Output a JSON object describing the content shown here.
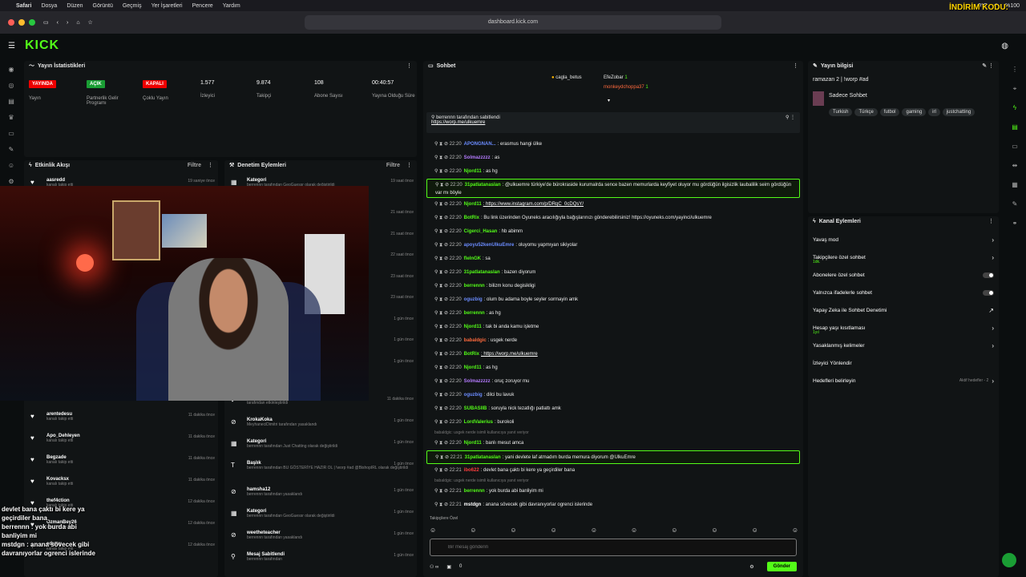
{
  "mac": {
    "app": "Safari",
    "menus": [
      "Dosya",
      "Düzen",
      "Görüntü",
      "Geçmiş",
      "Yer İşaretleri",
      "Pencere",
      "Yardım"
    ],
    "weather": "9°C",
    "battery": "%100",
    "promo": "İNDİRİM KODU:"
  },
  "browser": {
    "url": "dashboard.kick.com"
  },
  "kick": {
    "logo": "KICK"
  },
  "stats": {
    "title": "Yayın İstatistikleri",
    "live_badge": "YAYINDA",
    "live_label": "Yayın",
    "partner_badge": "AÇIK",
    "partner_label": "Partnerlik Gelir Programı",
    "multi_badge": "KAPALI",
    "multi_label": "Çoklu Yayın",
    "viewers": "1.577",
    "viewers_label": "İzleyici",
    "followers": "9.874",
    "followers_label": "Takipçi",
    "subs": "108",
    "subs_label": "Abone Sayısı",
    "uptime": "00:40:57",
    "uptime_label": "Yayına Olduğu Süre"
  },
  "activity": {
    "title": "Etkinlik Akışı",
    "filter": "Filtre",
    "items": [
      {
        "name": "aasredd",
        "sub": "kanalı takip etti",
        "time": "19 saniye önce"
      },
      {
        "name": "arentedesu",
        "sub": "kanalı takip etti",
        "time": "11 dakika önce"
      },
      {
        "name": "Apo_Dehleyen",
        "sub": "kanalı takip etti",
        "time": "11 dakika önce"
      },
      {
        "name": "Begzade",
        "sub": "kanalı takip etti",
        "time": "11 dakika önce"
      },
      {
        "name": "Kovacksx",
        "sub": "kanalı takip etti",
        "time": "11 dakika önce"
      },
      {
        "name": "thef4ction",
        "sub": "kanalı takip etti",
        "time": "12 dakika önce"
      },
      {
        "name": "OzmanBey26",
        "sub": "kanalı takip etti",
        "time": "12 dakika önce"
      },
      {
        "name": "edusw",
        "sub": "kanalı takip etti",
        "time": "12 dakika önce"
      }
    ]
  },
  "moderation": {
    "title": "Denetim Eylemleri",
    "filter": "Filtre",
    "top": [
      {
        "name": "Kategori",
        "sub": "berrennn tarafından GeoGuessr olarak değiştirildi",
        "time": "19 saat önce"
      }
    ],
    "side_times": [
      "21 saat önce",
      "21 saat önce",
      "22 saat önce",
      "23 saat önce",
      "23 saat önce",
      "1 gün önce",
      "1 gün önce",
      "1 gün önce"
    ],
    "items": [
      {
        "name": "UlkuEmre",
        "sub": "tarafından etkinleştirildi",
        "time": "11 dakika önce"
      },
      {
        "name": "KrokaKoka",
        "sub": "MeyhaneciDimitri tarafından yasaklandı",
        "time": "1 gün önce"
      },
      {
        "name": "Kategori",
        "sub": "berrennn tarafından Just Chatting olarak değiştirildi",
        "time": "1 gün önce"
      },
      {
        "name": "Başlık",
        "sub": "berrennn tarafından BU GÖSTERİYE HAZIR OL | !worp #ad @BishopIRL olarak değiştirildi",
        "time": "1 gün önce"
      },
      {
        "name": "hamsha12",
        "sub": "berrennn tarafından yasaklandı",
        "time": "1 gün önce"
      },
      {
        "name": "Kategori",
        "sub": "berrennn tarafından GeoGuessr olarak değiştirildi",
        "time": "1 gün önce"
      },
      {
        "name": "weetheteacher",
        "sub": "berrennn tarafından yasaklandı",
        "time": "1 gün önce"
      },
      {
        "name": "Mesaj Sabitlendi",
        "sub": "berrennn tarafından",
        "time": "1 gün önce"
      }
    ]
  },
  "overlay_chat": [
    "devlet bana çaktı bi kere ya",
    "geçirdiler bana",
    "berrennn : yok burda abi",
    "banliyim mi",
    "mstdgn : anana sövecek gibi",
    "davranıyorlar ogrenci islerinde"
  ],
  "chat": {
    "title": "Sohbet",
    "leaders": [
      {
        "name": "cagla_betus",
        "n": "1"
      },
      {
        "name": "EfeZobar",
        "n": "1"
      },
      {
        "name": "monkeydchoppa37",
        "n": "1"
      }
    ],
    "pinned_by": "berrennn tarafından sabitlendi",
    "pinned_link": "https://worp.me/ulkuemre",
    "messages": [
      {
        "time": "22:20",
        "user": "APONGNAN...",
        "color": "#6b8cff",
        "text": ": erasmus hangi ülke",
        "type": "normal"
      },
      {
        "time": "22:20",
        "user": "Solmazzzzz",
        "color": "#b57bff",
        "text": ": as",
        "type": "normal"
      },
      {
        "time": "22:20",
        "user": "Njord11",
        "color": "#53fc18",
        "text": ": as hg",
        "type": "normal"
      },
      {
        "time": "22:20",
        "user": "31patlatanaslan",
        "color": "#53fc18",
        "text": ": @ulkuemre türkiye'de bürokraside kurumalrda sence bazen memurlarda keyfiyet oluyor mu gördüğün ilgisizlik laubalilik seim gördüğün var mı böyle",
        "type": "big"
      },
      {
        "time": "22:20",
        "user": "Njord11",
        "color": "#53fc18",
        "text": ": https://www.instagram.com/p/DRqC_0cDQsY/",
        "type": "link"
      },
      {
        "time": "22:20",
        "user": "BotRix",
        "color": "#53fc18",
        "text": ": Bu link üzerinden Oyuneks aracılığıyla bağışlarınızı gönderebilirsiniz! https://oyuneks.com/yayinci/ulkuemre",
        "type": "normal"
      },
      {
        "time": "22:20",
        "user": "Cigerci_Hasan",
        "color": "#53fc18",
        "text": ": hb abimm",
        "type": "normal"
      },
      {
        "time": "22:20",
        "user": "apoyu52kenUlkuEmre",
        "color": "#6b8cff",
        "text": ": oluyomu yapmıyan sikiyolar",
        "type": "normal"
      },
      {
        "time": "22:20",
        "user": "flelnGK",
        "color": "#53fc18",
        "text": ": sa",
        "type": "normal"
      },
      {
        "time": "22:20",
        "user": "31patlatanaslan",
        "color": "#53fc18",
        "text": ": bazen diyorum",
        "type": "normal"
      },
      {
        "time": "22:20",
        "user": "berrennn",
        "color": "#53fc18",
        "text": ": bilizm konu degisikligi",
        "type": "normal"
      },
      {
        "time": "22:20",
        "user": "oguzbig",
        "color": "#6b8cff",
        "text": ": olum bu adama boyle seyler sormayin amk",
        "type": "normal"
      },
      {
        "time": "22:20",
        "user": "berrennn",
        "color": "#53fc18",
        "text": ": as hg",
        "type": "normal"
      },
      {
        "time": "22:20",
        "user": "Njord11",
        "color": "#53fc18",
        "text": ": tak bi anda kamu işletme",
        "type": "normal"
      },
      {
        "time": "22:20",
        "user": "babaldgic",
        "color": "#ff6a3d",
        "text": ": usgek nerde",
        "type": "normal"
      },
      {
        "time": "22:20",
        "user": "BotRix",
        "color": "#53fc18",
        "text": ": https://worp.me/ulkuemre",
        "type": "link"
      },
      {
        "time": "22:20",
        "user": "Njord11",
        "color": "#53fc18",
        "text": ": as hg",
        "type": "normal"
      },
      {
        "time": "22:20",
        "user": "Solmazzzzz",
        "color": "#b57bff",
        "text": ": oruç zoruyor mu",
        "type": "normal"
      },
      {
        "time": "22:20",
        "user": "oguzbig",
        "color": "#6b8cff",
        "text": ": dilci bu lavuk",
        "type": "normal"
      },
      {
        "time": "22:20",
        "user": "SUBASIIB",
        "color": "#53fc18",
        "text": ": soruyla nick tezatlığı patlattı amk",
        "type": "normal"
      },
      {
        "time": "22:20",
        "user": "LordValerius",
        "color": "#53fc18",
        "text": ": burokoli",
        "type": "normal"
      },
      {
        "time": "",
        "user": "",
        "color": "#777",
        "text": "babaldgic: usgek nerde isimli kullanıcıya yanıt veriyor",
        "type": "reply"
      },
      {
        "time": "22:20",
        "user": "Njord11",
        "color": "#53fc18",
        "text": ": banlı mesut amca",
        "type": "normal"
      },
      {
        "time": "22:21",
        "user": "31patlatanaslan",
        "color": "#53fc18",
        "text": ": yani devlete laf atmadım burda memura diyorum @UlkuEmre",
        "type": "hl"
      },
      {
        "time": "22:21",
        "user": "ibo622",
        "color": "#ff3d3d",
        "text": ": devlet bana çaktı bi kere ya geçirdiler bana",
        "type": "normal"
      },
      {
        "time": "",
        "user": "",
        "color": "#777",
        "text": "babaldgic: usgek nerde isimli kullanıcıya yanıt veriyor",
        "type": "reply"
      },
      {
        "time": "22:21",
        "user": "berrennn",
        "color": "#53fc18",
        "text": ": yok burda abi banliyim mi",
        "type": "normal"
      },
      {
        "time": "22:21",
        "user": "mstdgn",
        "color": "#ffffff",
        "text": ": anana sövecek gibi davranıyorlar ogrenci islerinde",
        "type": "normal"
      }
    ],
    "follower_only": "Takipçilere Özel",
    "placeholder": "Bir mesaj gönderin",
    "counter": "0",
    "send": "Gönder"
  },
  "info": {
    "title": "Yayın bilgisi",
    "stream_title": "ramazan 2 | !worp #ad",
    "category": "Sadece Sohbet",
    "tags": [
      "Turkish",
      "Türkçe",
      "futbol",
      "gaming",
      "irl",
      "justchatting"
    ]
  },
  "channel": {
    "title": "Kanal Eylemleri",
    "rows": [
      {
        "label": "Yavaş mod",
        "sub": "",
        "ctrl": "chev"
      },
      {
        "label": "Takipçilere özel sohbet",
        "sub": "1dk.",
        "ctrl": "chev"
      },
      {
        "label": "Abonelere özel sohbet",
        "sub": "",
        "ctrl": "toggle"
      },
      {
        "label": "Yalnızca ifadelerle sohbet",
        "sub": "",
        "ctrl": "toggle"
      },
      {
        "label": "Yapay Zeka ile Sohbet Denetimi",
        "sub": "",
        "ctrl": "ext"
      },
      {
        "label": "Hesap yaşı kısıtlaması",
        "sub": "1yıl",
        "ctrl": "chev"
      },
      {
        "label": "Yasaklanmış kelimeler",
        "sub": "",
        "ctrl": "chev"
      },
      {
        "label": "İzleyici Yönlendir",
        "sub": "",
        "ctrl": "none"
      },
      {
        "label": "Hedefleri belirleyin",
        "sub": "",
        "ctrl": "goal"
      }
    ],
    "goal_text": "Aktif hedefler - 2"
  },
  "colors": {
    "accent": "#53fc18",
    "live": "#e00000",
    "panel": "#111415"
  }
}
